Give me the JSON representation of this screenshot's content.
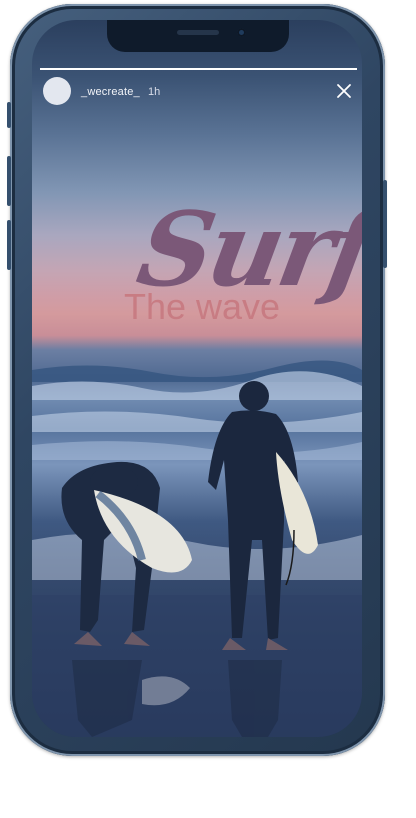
{
  "story": {
    "username": "_wecreate_",
    "time": "1h",
    "title": "Surf",
    "subtitle": "The wave",
    "progress": 1.0
  },
  "icons": {
    "close": "close-icon",
    "camera": "camera-icon"
  },
  "colors": {
    "title": "#7b5878",
    "subtitle": "#c87c83",
    "frame": "#2f4662"
  }
}
